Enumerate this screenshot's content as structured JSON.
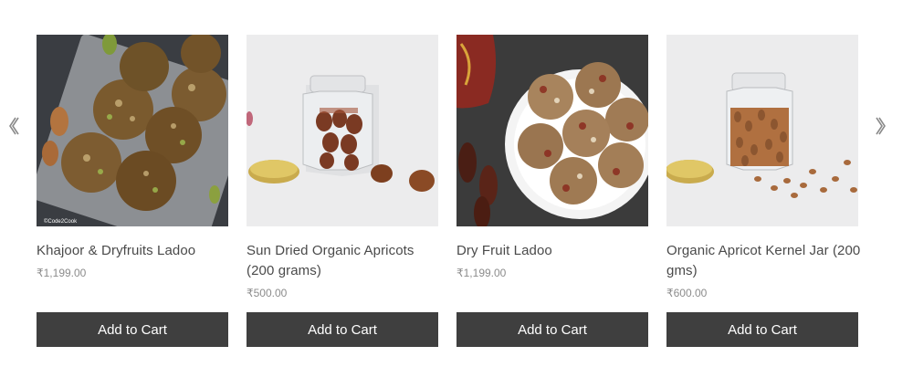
{
  "navigation": {
    "prev_icon": "chevron-left-icon",
    "next_icon": "chevron-right-icon"
  },
  "products": [
    {
      "title": "Khajoor & Dryfruits Ladoo",
      "price": "₹1,199.00",
      "button_label": "Add to Cart",
      "image_caption": "©Code2Cook"
    },
    {
      "title": "Sun Dried Organic Apricots (200 grams)",
      "price": "₹500.00",
      "button_label": "Add to Cart"
    },
    {
      "title": "Dry Fruit Ladoo",
      "price": "₹1,199.00",
      "button_label": "Add to Cart"
    },
    {
      "title": "Organic Apricot Kernel Jar (200 gms)",
      "price": "₹600.00",
      "button_label": "Add to Cart"
    }
  ],
  "colors": {
    "button_bg": "#3f3f3f",
    "button_text": "#ffffff",
    "title_text": "#4a4a4a",
    "price_text": "#8c8c8c"
  }
}
